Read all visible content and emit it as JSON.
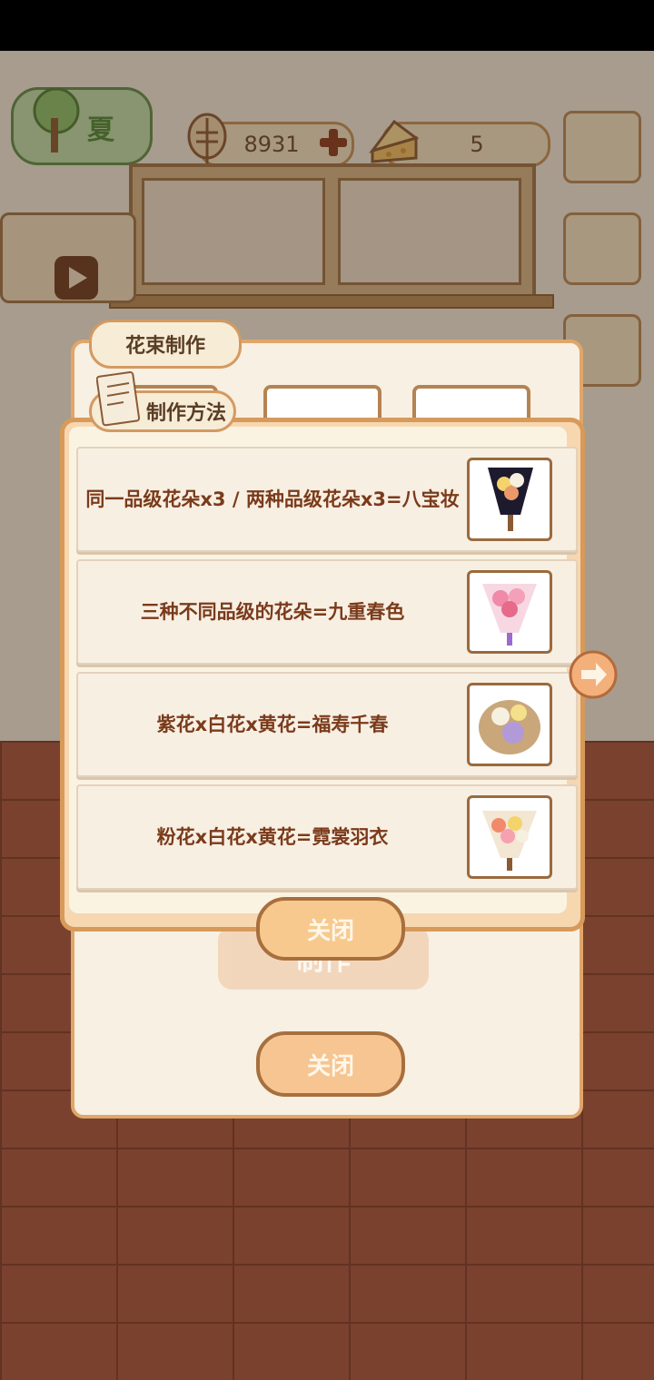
{
  "hud": {
    "season": "夏",
    "coins": "8931",
    "cheese": "5"
  },
  "back_panel": {
    "title": "花束制作",
    "make_label": "制作",
    "close_label": "关闭"
  },
  "recipes_panel": {
    "title": "制作方法",
    "close_label": "关闭",
    "recipes": [
      {
        "text": "同一品级花朵x3 / 两种品级花朵x3=八宝妆",
        "thumb": "dark-bouquet"
      },
      {
        "text": "三种不同品级的花朵=九重春色",
        "thumb": "pink-bouquet"
      },
      {
        "text": "紫花x白花x黄花=福寿千春",
        "thumb": "basket-bouquet"
      },
      {
        "text": "粉花x白花x黄花=霓裳羽衣",
        "thumb": "mixed-bouquet"
      }
    ]
  },
  "colors": {
    "accent": "#d89a5a",
    "text": "#7a3b1b",
    "button": "#f8c98e"
  }
}
